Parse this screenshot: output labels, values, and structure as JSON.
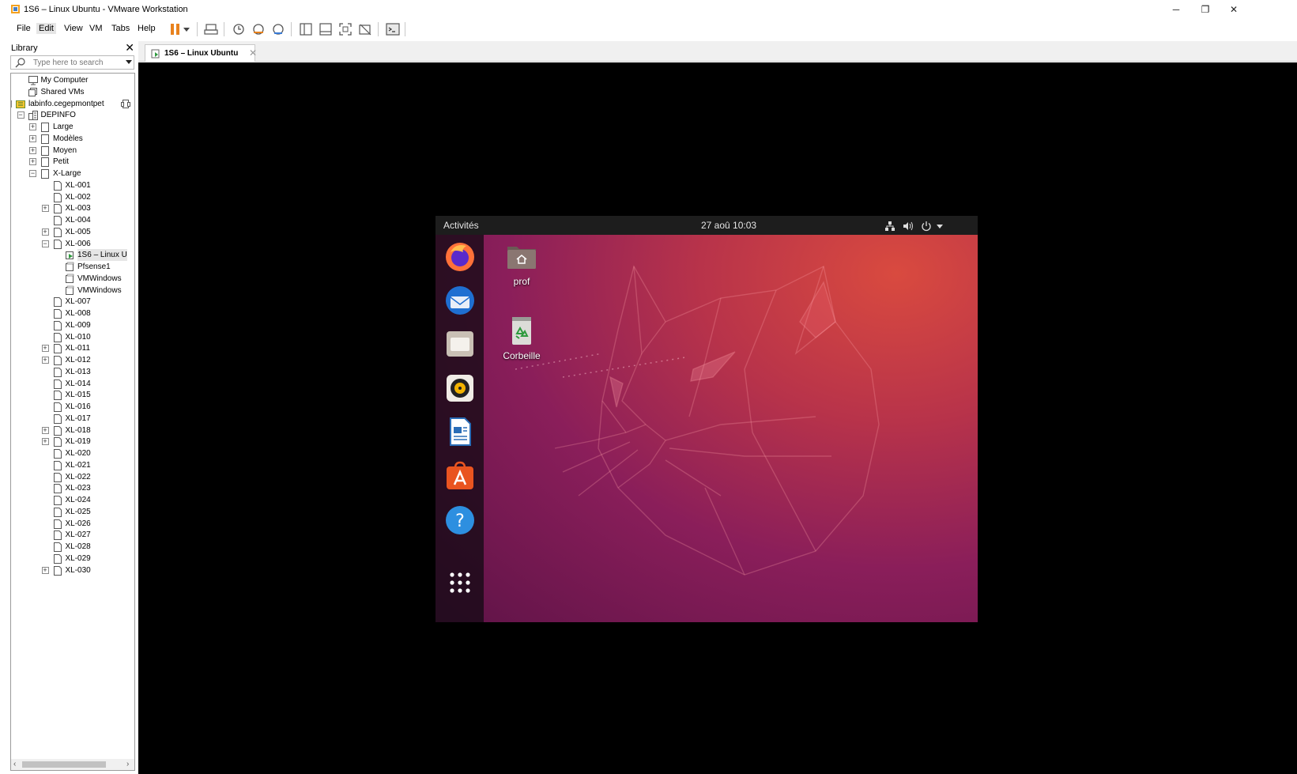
{
  "window": {
    "title": "1S6 – Linux Ubuntu - VMware Workstation",
    "controls": {
      "minimize": "─",
      "restore": "❐",
      "close": "✕"
    }
  },
  "menu": {
    "items": [
      {
        "label": "File"
      },
      {
        "label": "Edit"
      },
      {
        "label": "View"
      },
      {
        "label": "VM"
      },
      {
        "label": "Tabs"
      },
      {
        "label": "Help"
      }
    ]
  },
  "toolbar": {
    "icons": [
      "pause-icon",
      "dropdown-arrow-icon",
      "send-ctrl-alt-del-icon",
      "snapshot-icon",
      "revert-snapshot-icon",
      "snapshot-manager-icon",
      "library-view-icon",
      "thumbnail-bar-icon",
      "fullscreen-icon",
      "unity-icon",
      "console-view-icon"
    ],
    "accent": "#e8821e"
  },
  "library": {
    "title": "Library",
    "close": "✕",
    "search_placeholder": "Type here to search",
    "tree": [
      {
        "label": "My Computer"
      },
      {
        "label": "Shared VMs"
      },
      {
        "label": "labinfo.cegepmontpet"
      },
      {
        "label": "DEPINFO"
      },
      {
        "label": "Large"
      },
      {
        "label": "Modèles"
      },
      {
        "label": "Moyen"
      },
      {
        "label": "Petit"
      },
      {
        "label": "X-Large"
      },
      {
        "label": "XL-001"
      },
      {
        "label": "XL-002"
      },
      {
        "label": "XL-003"
      },
      {
        "label": "XL-004"
      },
      {
        "label": "XL-005"
      },
      {
        "label": "XL-006"
      },
      {
        "label": "1S6 – Linux U"
      },
      {
        "label": "Pfsense1"
      },
      {
        "label": "VMWindows"
      },
      {
        "label": "VMWindows"
      },
      {
        "label": "XL-007"
      },
      {
        "label": "XL-008"
      },
      {
        "label": "XL-009"
      },
      {
        "label": "XL-010"
      },
      {
        "label": "XL-011"
      },
      {
        "label": "XL-012"
      },
      {
        "label": "XL-013"
      },
      {
        "label": "XL-014"
      },
      {
        "label": "XL-015"
      },
      {
        "label": "XL-016"
      },
      {
        "label": "XL-017"
      },
      {
        "label": "XL-018"
      },
      {
        "label": "XL-019"
      },
      {
        "label": "XL-020"
      },
      {
        "label": "XL-021"
      },
      {
        "label": "XL-022"
      },
      {
        "label": "XL-023"
      },
      {
        "label": "XL-024"
      },
      {
        "label": "XL-025"
      },
      {
        "label": "XL-026"
      },
      {
        "label": "XL-027"
      },
      {
        "label": "XL-028"
      },
      {
        "label": "XL-029"
      },
      {
        "label": "XL-030"
      }
    ]
  },
  "tabs": [
    {
      "label": "1S6 – Linux Ubuntu",
      "close": "✕"
    }
  ],
  "ubuntu": {
    "activities": "Activités",
    "clock": "27 aoû  10:03",
    "dock": [
      "firefox-icon",
      "thunderbird-icon",
      "files-icon",
      "rhythmbox-icon",
      "libreoffice-writer-icon",
      "software-center-icon",
      "help-icon",
      "show-apps-icon"
    ],
    "desktop_icons": [
      {
        "label": "prof",
        "icon": "home-folder-icon"
      },
      {
        "label": "Corbeille",
        "icon": "trash-icon"
      }
    ],
    "top_bar_icons": [
      "network-icon",
      "volume-icon",
      "power-icon",
      "menu-arrow-icon"
    ]
  }
}
